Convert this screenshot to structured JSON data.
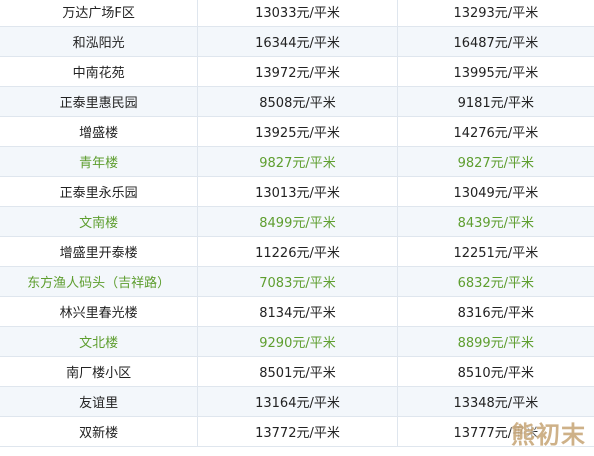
{
  "rows": [
    {
      "name": "万达广场F区",
      "price_a": "13033元/平米",
      "price_b": "13293元/平米",
      "highlight": false
    },
    {
      "name": "和泓阳光",
      "price_a": "16344元/平米",
      "price_b": "16487元/平米",
      "highlight": false
    },
    {
      "name": "中南花苑",
      "price_a": "13972元/平米",
      "price_b": "13995元/平米",
      "highlight": false
    },
    {
      "name": "正泰里惠民园",
      "price_a": "8508元/平米",
      "price_b": "9181元/平米",
      "highlight": false
    },
    {
      "name": "增盛楼",
      "price_a": "13925元/平米",
      "price_b": "14276元/平米",
      "highlight": false
    },
    {
      "name": "青年楼",
      "price_a": "9827元/平米",
      "price_b": "9827元/平米",
      "highlight": true
    },
    {
      "name": "正泰里永乐园",
      "price_a": "13013元/平米",
      "price_b": "13049元/平米",
      "highlight": false
    },
    {
      "name": "文南楼",
      "price_a": "8499元/平米",
      "price_b": "8439元/平米",
      "highlight": true
    },
    {
      "name": "增盛里开泰楼",
      "price_a": "11226元/平米",
      "price_b": "12251元/平米",
      "highlight": false
    },
    {
      "name": "东方渔人码头（吉祥路）",
      "price_a": "7083元/平米",
      "price_b": "6832元/平米",
      "highlight": true
    },
    {
      "name": "林兴里春光楼",
      "price_a": "8134元/平米",
      "price_b": "8316元/平米",
      "highlight": false
    },
    {
      "name": "文北楼",
      "price_a": "9290元/平米",
      "price_b": "8899元/平米",
      "highlight": true
    },
    {
      "name": "南厂楼小区",
      "price_a": "8501元/平米",
      "price_b": "8510元/平米",
      "highlight": false
    },
    {
      "name": "友谊里",
      "price_a": "13164元/平米",
      "price_b": "13348元/平米",
      "highlight": false
    },
    {
      "name": "双新楼",
      "price_a": "13772元/平米",
      "price_b": "13777元/平米",
      "highlight": false
    }
  ],
  "watermark": "熊初末",
  "colors": {
    "highlight_text": "#5e9e2f",
    "row_alt_bg": "#f3f7fb",
    "border": "#dfe6ee"
  }
}
